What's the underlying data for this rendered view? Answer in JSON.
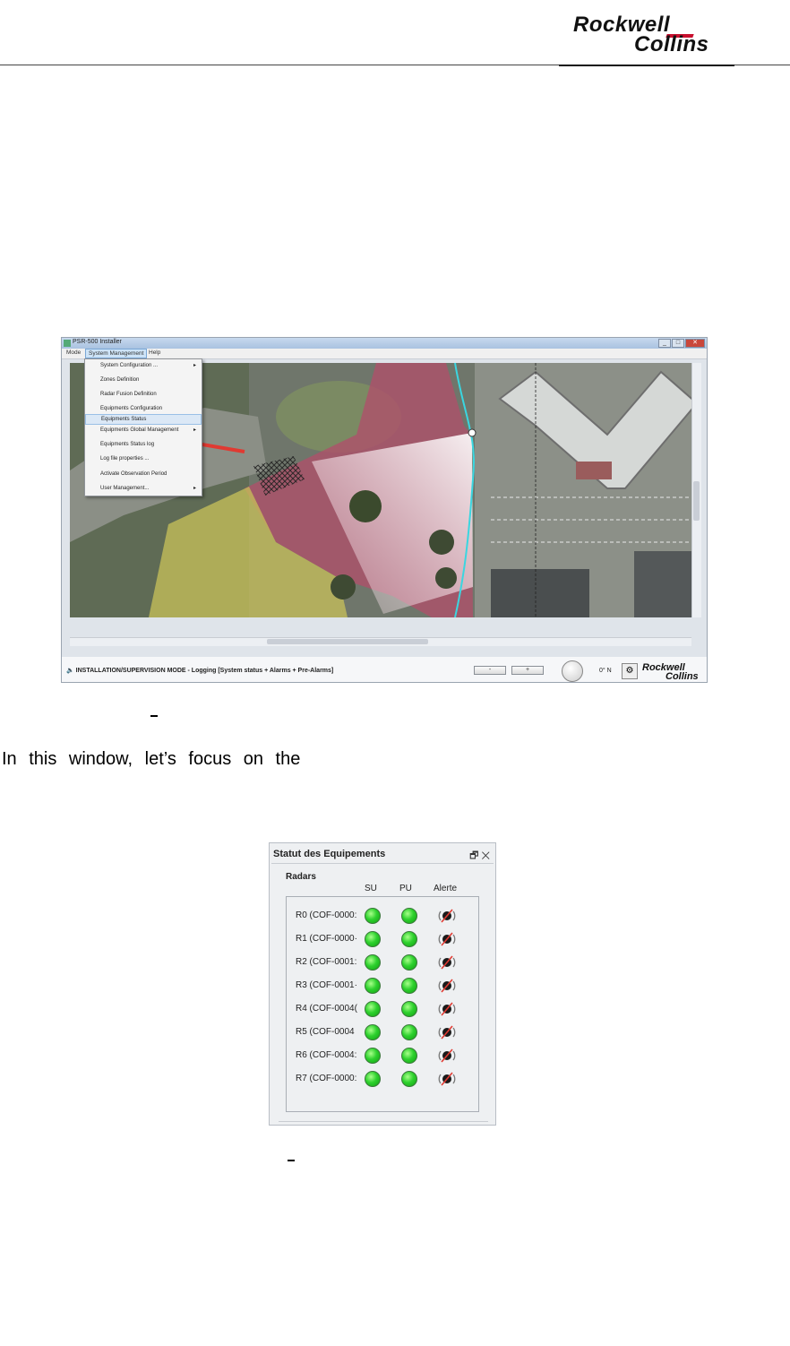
{
  "header": {
    "logo_line1": "Rockwell",
    "logo_line2": "Collins"
  },
  "app": {
    "title": "PSR-500 Installer",
    "window_buttons": [
      "_",
      "□",
      "✕"
    ],
    "menu": [
      "Mode",
      "System Management",
      "Help"
    ],
    "dropdown": [
      {
        "label": "System Configuration ...",
        "submenu": true
      },
      {
        "label": "Zones Definition",
        "submenu": false
      },
      {
        "label": "Radar Fusion Definition",
        "submenu": false
      },
      {
        "label": "Equipments Configuration",
        "submenu": false
      },
      {
        "label": "Equipments Status",
        "submenu": false
      },
      {
        "label": "Equipments Global Management",
        "submenu": true
      },
      {
        "label": "Equipments Status log",
        "submenu": false
      },
      {
        "label": "Log file properties ...",
        "submenu": false
      },
      {
        "label": "Activate Observation Period",
        "submenu": false
      },
      {
        "label": "User Management...",
        "submenu": true
      }
    ],
    "status_text": "INSTALLATION/SUPERVISION MODE - Logging [System status + Alarms + Pre-Alarms]",
    "zoom_out": "-",
    "zoom_in": "+",
    "heading": "0° N",
    "logo_line1": "Rockwell",
    "logo_line2": "Collins"
  },
  "body_text": "In this window, let’s focus on the",
  "panel": {
    "title": "Statut des Equipements",
    "group": "Radars",
    "columns": [
      "SU",
      "PU",
      "Alerte"
    ],
    "rows": [
      {
        "label": "R0 (COF-0000:"
      },
      {
        "label": "R1 (COF-0000·"
      },
      {
        "label": "R2 (COF-0001:"
      },
      {
        "label": "R3 (COF-0001·"
      },
      {
        "label": "R4 (COF-0004("
      },
      {
        "label": "R5 (COF-0004"
      },
      {
        "label": "R6 (COF-0004:"
      },
      {
        "label": "R7 (COF-0000:"
      }
    ]
  },
  "colors": {
    "led_on": "#2ed12e",
    "menu_highlight": "#dbe8f6",
    "arrow": "#e03a32",
    "radar_zone": "#b0506a",
    "yellow_zone": "#c8c25a"
  }
}
